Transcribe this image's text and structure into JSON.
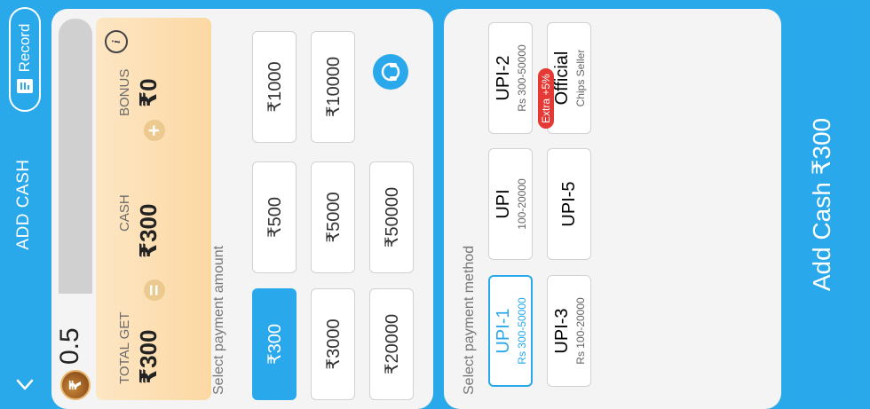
{
  "header": {
    "title": "ADD CASH",
    "record_label": "Record"
  },
  "balance": {
    "value": "0.5"
  },
  "summary": {
    "total_label": "TOTAL GET",
    "total_value": "₹300",
    "cash_label": "CASH",
    "cash_value": "₹300",
    "bonus_label": "BONUS",
    "bonus_value": "₹0",
    "equals": "=",
    "plus": "+",
    "info": "i"
  },
  "amount": {
    "label": "Select payment amount",
    "options": [
      "₹300",
      "₹500",
      "₹1000",
      "₹3000",
      "₹5000",
      "₹10000",
      "₹20000",
      "₹50000"
    ],
    "selected": "₹300"
  },
  "method": {
    "label": "Select payment method",
    "upi1": {
      "name": "UPI-1",
      "range": "Rs 300-50000"
    },
    "upi": {
      "name": "UPI",
      "range": "100-20000"
    },
    "upi2": {
      "name": "UPI-2",
      "range": "Rs 300-50000"
    },
    "upi3": {
      "name": "UPI-3",
      "range": "Rs 100-20000"
    },
    "upi5": {
      "name": "UPI-5"
    },
    "official": {
      "name": "Official",
      "sub": "Chips Seller",
      "badge": "Extra +5%"
    }
  },
  "cta": {
    "label": "Add Cash ₹300"
  },
  "colors": {
    "accent": "#29a8eb",
    "card": "#fcd8a3",
    "badge": "#e53935"
  }
}
